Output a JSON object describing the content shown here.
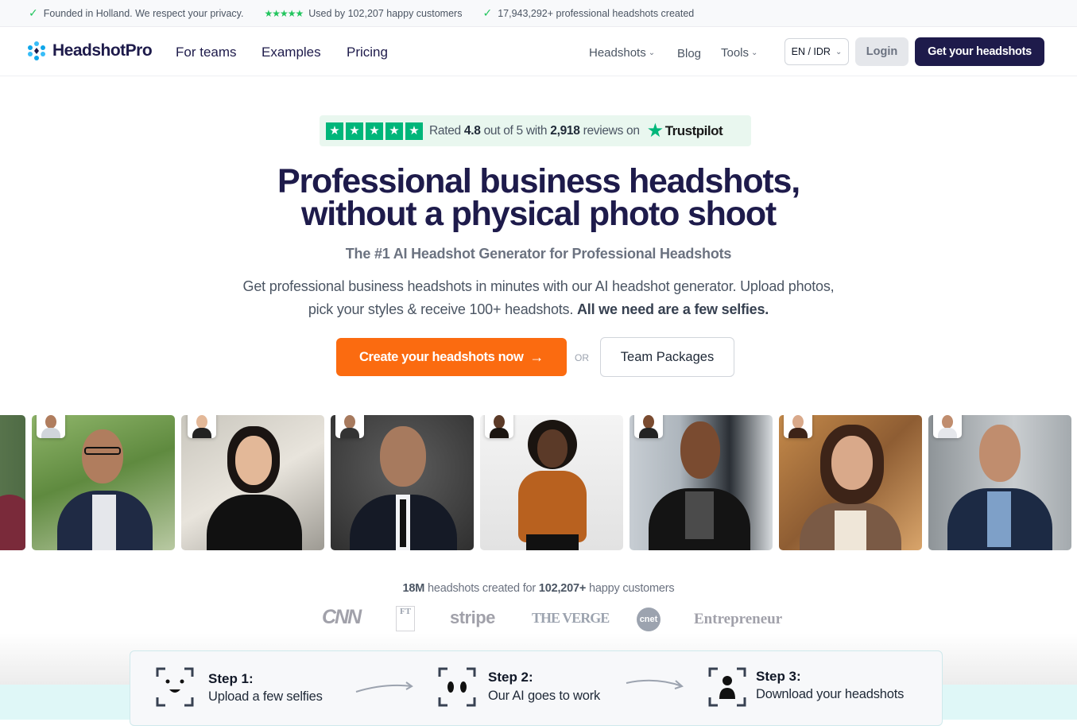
{
  "topbar": {
    "item1": "Founded in Holland. We respect your privacy.",
    "item2": "Used by 102,207 happy customers",
    "item3": "17,943,292+ professional headshots created",
    "stars": "★★★★★"
  },
  "nav": {
    "logo": "HeadshotPro",
    "links": [
      "For teams",
      "Examples",
      "Pricing"
    ],
    "headshots": "Headshots",
    "blog": "Blog",
    "tools": "Tools",
    "lang": "EN / IDR",
    "login": "Login",
    "cta": "Get your headshots"
  },
  "trust": {
    "rated": "Rated",
    "score": "4.8",
    "out_of": "out of 5 with",
    "count": "2,918",
    "reviews_on": "reviews on",
    "brand": "Trustpilot"
  },
  "hero": {
    "title_line1": "Professional business headshots,",
    "title_line2": "without a physical photo shoot",
    "subtitle": "The #1 AI Headshot Generator for Professional Headshots",
    "desc": "Get professional business headshots in minutes with our AI headshot generator. Upload photos, pick your styles & receive 100+ headshots.",
    "desc_bold": "All we need are a few selfies.",
    "cta": "Create your headshots now",
    "or": "OR",
    "team": "Team Packages"
  },
  "stats": {
    "count": "18M",
    "mid": "headshots created for",
    "customers": "102,207+",
    "end": "happy customers"
  },
  "press": [
    "CNN",
    "FT",
    "stripe",
    "THE VERGE",
    "cnet",
    "Entrepreneur"
  ],
  "steps": [
    {
      "title": "Step 1:",
      "desc": "Upload a few selfies"
    },
    {
      "title": "Step 2:",
      "desc": "Our AI goes to work"
    },
    {
      "title": "Step 3:",
      "desc": "Download your headshots"
    }
  ],
  "colors": {
    "brand": "#1e1b4b",
    "cta": "#fb6b10",
    "trust": "#00b67a"
  }
}
